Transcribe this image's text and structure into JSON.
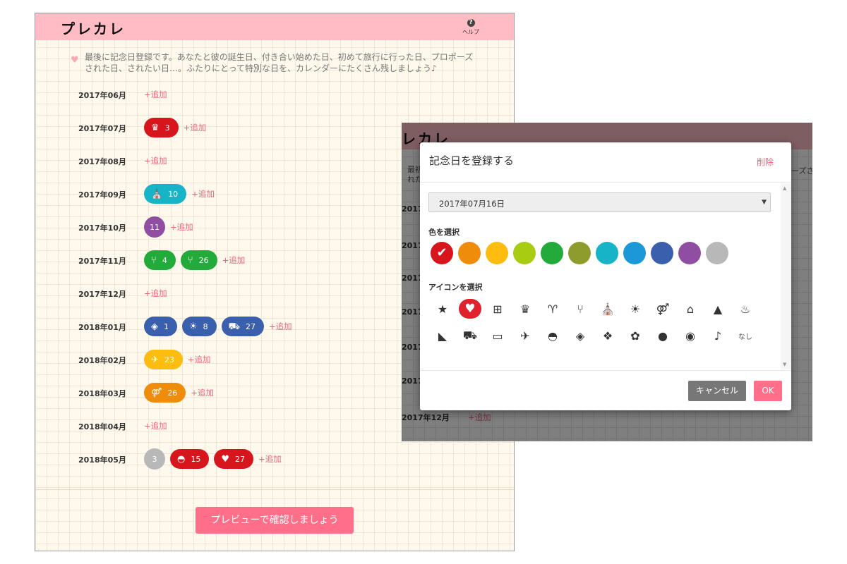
{
  "app": {
    "title": "プレカレ",
    "help_label": "ヘルプ",
    "intro_text": "最後に記念日登録です。あなたと彼の誕生日、付き合い始めた日、初めて旅行に行った日、プロポーズされた日、されたい日…。ふたりにとって特別な日を、カレンダーにたくさん残しましょう♪",
    "add_label": "+追加",
    "preview_button": "プレビューで確認しましょう",
    "colors": {
      "pink_bar": "#ffbcc5",
      "accent": "#ff6f8a",
      "link": "#e8667d"
    }
  },
  "months": [
    {
      "label": "2017年06月",
      "items": []
    },
    {
      "label": "2017年07月",
      "items": [
        {
          "icon": "cake-icon",
          "glyph": "♛",
          "day": "3",
          "color": "#d7151d"
        }
      ]
    },
    {
      "label": "2017年08月",
      "items": []
    },
    {
      "label": "2017年09月",
      "items": [
        {
          "icon": "church-icon",
          "glyph": "⛪",
          "day": "10",
          "color": "#16b4c6"
        }
      ]
    },
    {
      "label": "2017年10月",
      "items": [
        {
          "icon": "",
          "glyph": "",
          "day": "11",
          "color": "#8f4ea2"
        }
      ]
    },
    {
      "label": "2017年11月",
      "items": [
        {
          "icon": "fork-icon",
          "glyph": "⑂",
          "day": "4",
          "color": "#22ab3b"
        },
        {
          "icon": "fork-icon",
          "glyph": "⑂",
          "day": "26",
          "color": "#22ab3b"
        }
      ]
    },
    {
      "label": "2017年12月",
      "items": []
    },
    {
      "label": "2018年01月",
      "items": [
        {
          "icon": "chocolate-icon",
          "glyph": "◈",
          "day": "1",
          "color": "#3a60ad"
        },
        {
          "icon": "sunrise-icon",
          "glyph": "☀",
          "day": "8",
          "color": "#3a60ad"
        },
        {
          "icon": "car-icon",
          "glyph": "⛟",
          "day": "27",
          "color": "#3a60ad"
        }
      ]
    },
    {
      "label": "2018年02月",
      "items": [
        {
          "icon": "airplane-icon",
          "glyph": "✈",
          "day": "23",
          "color": "#fcbd10"
        }
      ]
    },
    {
      "label": "2018年03月",
      "items": [
        {
          "icon": "couple-icon",
          "glyph": "⚤",
          "day": "26",
          "color": "#f08c0c"
        }
      ]
    },
    {
      "label": "2018年04月",
      "items": []
    },
    {
      "label": "2018年05月",
      "items": [
        {
          "icon": "",
          "glyph": "",
          "day": "3",
          "color": "#b8b8b8"
        },
        {
          "icon": "fan-icon",
          "glyph": "◓",
          "day": "15",
          "color": "#d7151d"
        },
        {
          "icon": "heart-icon",
          "glyph": "♥",
          "day": "27",
          "color": "#d7151d"
        }
      ]
    }
  ],
  "background_window": {
    "title": "レカレ",
    "intro_fragment_1": "最初",
    "intro_fragment_2": "れた",
    "intro_fragment_right": "ーズさ",
    "month_fragment": "2017",
    "month_full": "2017年12月",
    "add_label": "+追加"
  },
  "modal": {
    "title": "記念日を登録する",
    "delete_label": "削除",
    "date_value": "2017年07月16日",
    "color_label": "色を選択",
    "icon_label": "アイコンを選択",
    "colors": [
      "#d7151d",
      "#f08c0c",
      "#fcbd10",
      "#a8cc12",
      "#22ab3b",
      "#8e9b2d",
      "#16b4c6",
      "#1a98d8",
      "#3a60ad",
      "#8f4ea2",
      "#b8b8b8"
    ],
    "selected_color_index": 0,
    "icons_row1": [
      {
        "name": "star-icon",
        "glyph": "★"
      },
      {
        "name": "heart-icon",
        "glyph": "♥"
      },
      {
        "name": "gift-icon",
        "glyph": "⊞"
      },
      {
        "name": "cake-icon",
        "glyph": "♛"
      },
      {
        "name": "wine-glass-icon",
        "glyph": "♈"
      },
      {
        "name": "fork-icon",
        "glyph": "⑂"
      },
      {
        "name": "church-icon",
        "glyph": "⛪"
      },
      {
        "name": "sunrise-icon",
        "glyph": "☀"
      },
      {
        "name": "couple-icon",
        "glyph": "⚤"
      },
      {
        "name": "house-icon",
        "glyph": "⌂"
      },
      {
        "name": "tent-icon",
        "glyph": "▲"
      },
      {
        "name": "hot-spring-icon",
        "glyph": "♨"
      }
    ],
    "icons_row2": [
      {
        "name": "megaphone-icon",
        "glyph": "◣"
      },
      {
        "name": "car-icon",
        "glyph": "⛟"
      },
      {
        "name": "train-icon",
        "glyph": "▭"
      },
      {
        "name": "airplane-icon",
        "glyph": "✈"
      },
      {
        "name": "fan-icon",
        "glyph": "◓"
      },
      {
        "name": "chocolate-icon",
        "glyph": "◈"
      },
      {
        "name": "candy-icon",
        "glyph": "❖"
      },
      {
        "name": "flower-icon",
        "glyph": "✿"
      },
      {
        "name": "ping-pong-icon",
        "glyph": "●"
      },
      {
        "name": "pumpkin-icon",
        "glyph": "◉"
      },
      {
        "name": "stocking-icon",
        "glyph": "♪"
      },
      {
        "name": "none",
        "glyph": "なし"
      }
    ],
    "selected_icon_index": 1,
    "cancel_label": "キャンセル",
    "ok_label": "OK"
  }
}
